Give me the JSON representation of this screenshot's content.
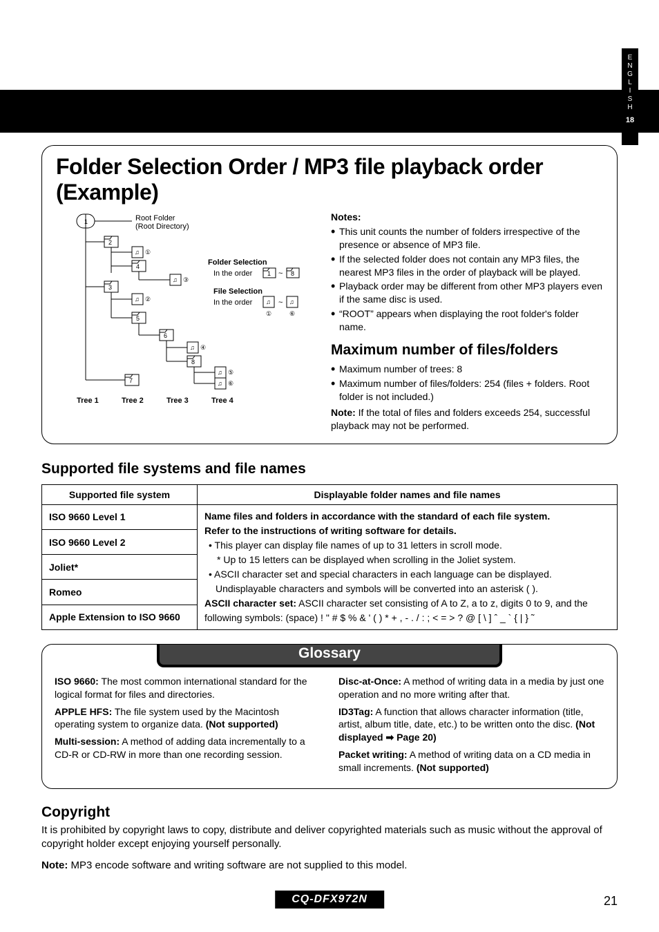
{
  "sideTab": {
    "lang": "ENGLISH",
    "pageNum": "18"
  },
  "folderSection": {
    "title": "Folder Selection Order / MP3 file playback order (Example)",
    "tree": {
      "rootLabel": "Root Folder",
      "rootSub": "(Root Directory)",
      "folderSelLabel": "Folder Selection",
      "folderSelOrder": "In the order",
      "fileSelLabel": "File Selection",
      "fileSelOrder": "In the order",
      "treeLabels": [
        "Tree 1",
        "Tree 2",
        "Tree 3",
        "Tree 4"
      ]
    },
    "notesHeading": "Notes:",
    "notes": [
      "This unit counts the number of folders irrespective of the presence or absence of MP3 file.",
      "If the selected folder does not contain any MP3 files, the nearest MP3 files in the order of playback will be played.",
      "Playback order may be different from other MP3 players even if the same disc is used.",
      "“ROOT” appears when displaying the root folder's folder name."
    ],
    "maxHeading": "Maximum number of files/folders",
    "maxItems": [
      "Maximum number of trees: 8",
      "Maximum number of files/folders: 254 (files + folders. Root folder is not included.)"
    ],
    "maxNoteLabel": "Note:",
    "maxNote": " If the total of files and folders exceeds 254, successful playback may not be performed."
  },
  "fsSection": {
    "heading": "Supported file systems and file names",
    "th1": "Supported file system",
    "th2": "Displayable folder names and file names",
    "rows": [
      "ISO 9660 Level 1",
      "ISO 9660 Level 2",
      "Joliet*",
      "Romeo",
      "Apple Extension to ISO 9660"
    ],
    "desc": {
      "line1a": "Name files and folders in accordance with the standard of each file system.",
      "line1b": "Refer to the instructions of writing software for details.",
      "bullet1": "This player can display file names of up to 31 letters in scroll mode.",
      "bullet1b": "* Up to 15 letters can be displayed when scrolling in the Joliet system.",
      "bullet2": "ASCII character set and special characters in each language can be displayed.",
      "line3": "Undisplayable characters and symbols will be converted into an asterisk (   ).",
      "asciiLabel": "ASCII character set:",
      "ascii": " ASCII character set consisting of A to Z, a to z, digits 0 to 9, and the following symbols: (space) ! \" # $ % & ' ( )  * + , - . / : ; < = > ? @ [ \\ ] ˆ _ ` { | } ˜"
    }
  },
  "glossary": {
    "title": "Glossary",
    "left": [
      {
        "term": "ISO 9660:",
        "def": " The most common international standard for the logical format for files and directories."
      },
      {
        "term": "APPLE HFS:",
        "def": " The file system used by the Macintosh operating system to organize data. ",
        "extra": "(Not supported)"
      },
      {
        "term": "Multi-session:",
        "def": "  A method of adding data incrementally to a CD-R or CD-RW in more than one recording session."
      }
    ],
    "right": [
      {
        "term": "Disc-at-Once:",
        "def": " A method of writing data in a media by just one operation and no more writing after that."
      },
      {
        "term": "ID3Tag:",
        "def": " A function that allows character information (title, artist, album title, date, etc.) to be written onto the disc. ",
        "extra": "(Not displayed ➡ Page 20)"
      },
      {
        "term": "Packet writing:",
        "def": " A method of writing data on a CD media in small increments. ",
        "extra": "(Not supported)"
      }
    ]
  },
  "copyright": {
    "heading": "Copyright",
    "body": "It is prohibited by copyright laws to copy, distribute and deliver copyrighted materials such as music without the approval of copyright holder except enjoying yourself personally.",
    "noteLabel": "Note:",
    "note": " MP3 encode software and writing software are not supplied to this model."
  },
  "footer": {
    "model": "CQ-DFX972N",
    "page": "21"
  }
}
